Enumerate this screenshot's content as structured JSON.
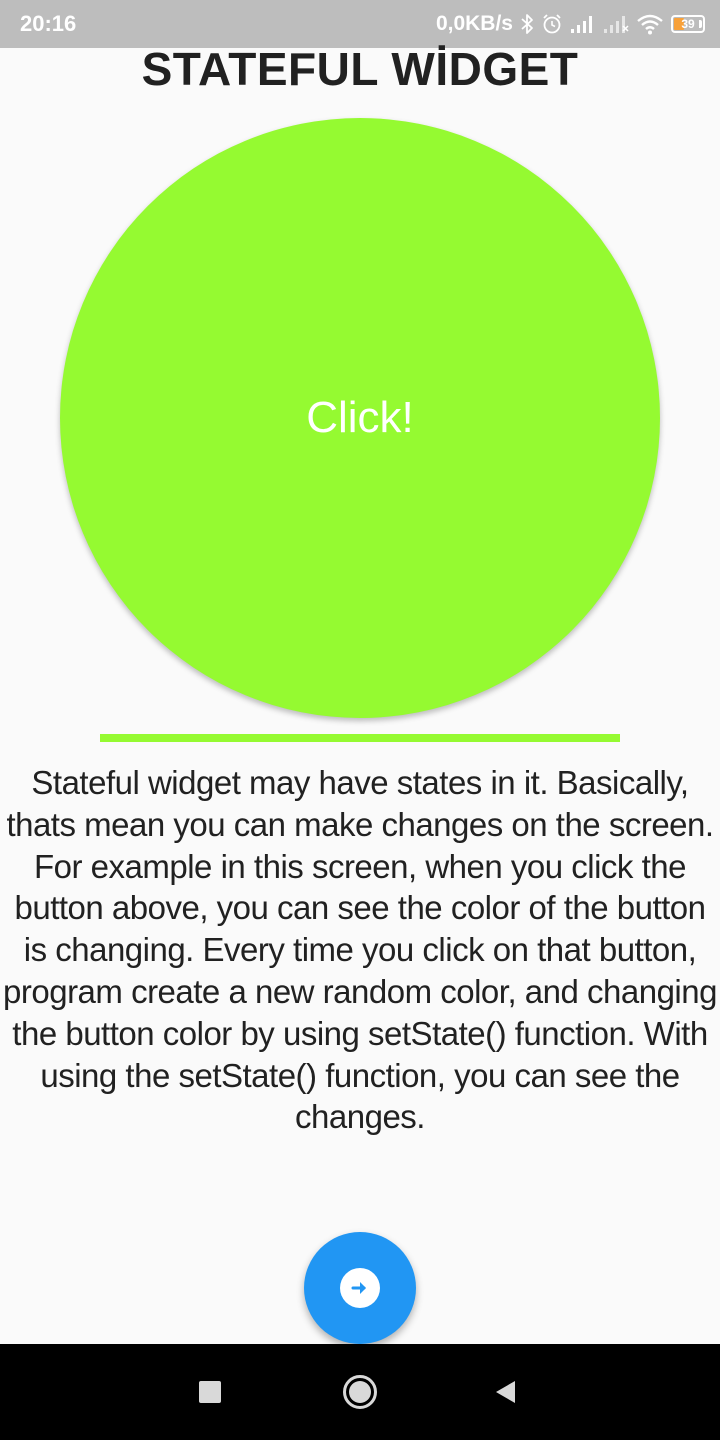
{
  "status_bar": {
    "time": "20:16",
    "network_speed": "0,0KB/s",
    "battery_level": "39",
    "icons": [
      "bluetooth-icon",
      "alarm-icon",
      "signal-icon",
      "signal-off-icon",
      "wifi-icon",
      "battery-icon"
    ]
  },
  "page": {
    "title": "STATEFUL WİDGET",
    "button_label": "Click!",
    "description": "Stateful widget may have states in it. Basically, thats mean you can make changes on the screen. For example in this screen, when you click the button above, you can see the color of the button is changing. Every time you click on that button, program create a new random color, and changing the button color by using setState() function. With using the setState() function, you can see the changes."
  },
  "colors": {
    "button_color": "#95fa31",
    "fab_color": "#2196f3",
    "background": "#fafafa",
    "status_bar": "#bdbdbd"
  },
  "fab": {
    "icon": "arrow-right-icon"
  },
  "navigation": {
    "items": [
      "recents-icon",
      "home-icon",
      "back-icon"
    ]
  }
}
